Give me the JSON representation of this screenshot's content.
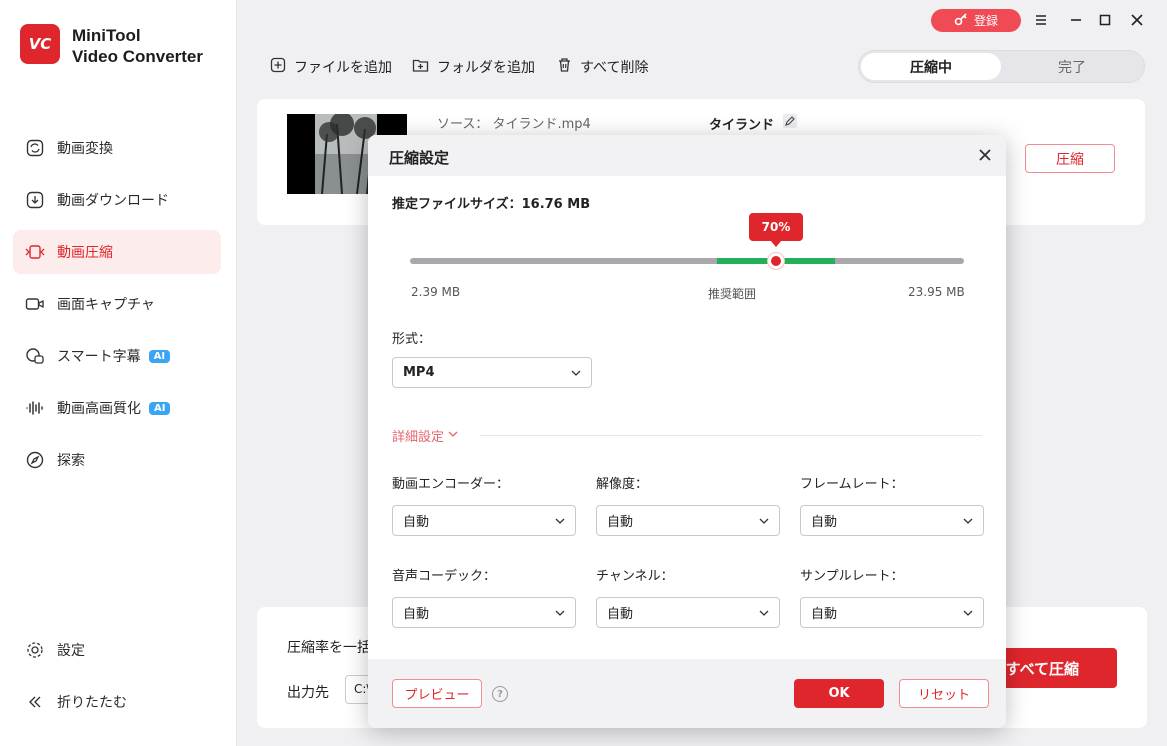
{
  "app": {
    "name_line1": "MiniTool",
    "name_line2": "Video Converter",
    "logo_text": "VC",
    "brand_color": "#e0262d"
  },
  "titlebar": {
    "register_label": "登録"
  },
  "sidebar": {
    "items": [
      {
        "label": "動画変換",
        "icon": "convert-icon"
      },
      {
        "label": "動画ダウンロード",
        "icon": "download-icon"
      },
      {
        "label": "動画圧縮",
        "icon": "compress-icon",
        "active": true
      },
      {
        "label": "画面キャプチャ",
        "icon": "camera-icon"
      },
      {
        "label": "スマート字幕",
        "icon": "subtitle-icon",
        "badge": "AI"
      },
      {
        "label": "動画高画質化",
        "icon": "enhance-icon",
        "badge": "AI"
      },
      {
        "label": "探索",
        "icon": "compass-icon"
      }
    ],
    "bottom": [
      {
        "label": "設定",
        "icon": "gear-icon"
      },
      {
        "label": "折りたたむ",
        "icon": "collapse-icon"
      }
    ]
  },
  "toolbar": {
    "add_file": "ファイルを追加",
    "add_folder": "フォルダを追加",
    "delete_all": "すべて削除"
  },
  "tabs": {
    "compressing": "圧縮中",
    "done": "完了"
  },
  "file": {
    "source": "ソース：  タイランド.mp4",
    "title": "タイランド",
    "compress_btn": "圧縮"
  },
  "bottom_bar": {
    "batch_label": "圧縮率を一括",
    "output_label": "出力先",
    "output_path": "C:\\",
    "compress_all": "すべて圧縮"
  },
  "modal": {
    "title": "圧縮設定",
    "est_size": "推定ファイルサイズ：16.76 MB",
    "slider_value": "70%",
    "slider_fraction": 0.7,
    "min_size": "2.39 MB",
    "recommended": "推奨範囲",
    "max_size": "23.95 MB",
    "format_label": "形式：",
    "format_value": "MP4",
    "advanced_label": "詳細設定",
    "fields": {
      "video_encoder": {
        "label": "動画エンコーダー：",
        "value": "自動"
      },
      "resolution": {
        "label": "解像度：",
        "value": "自動"
      },
      "frame_rate": {
        "label": "フレームレート：",
        "value": "自動"
      },
      "audio_codec": {
        "label": "音声コーデック：",
        "value": "自動"
      },
      "channel": {
        "label": "チャンネル：",
        "value": "自動"
      },
      "sample_rate": {
        "label": "サンプルレート：",
        "value": "自動"
      }
    },
    "preview": "プレビュー",
    "ok": "OK",
    "reset": "リセット"
  }
}
